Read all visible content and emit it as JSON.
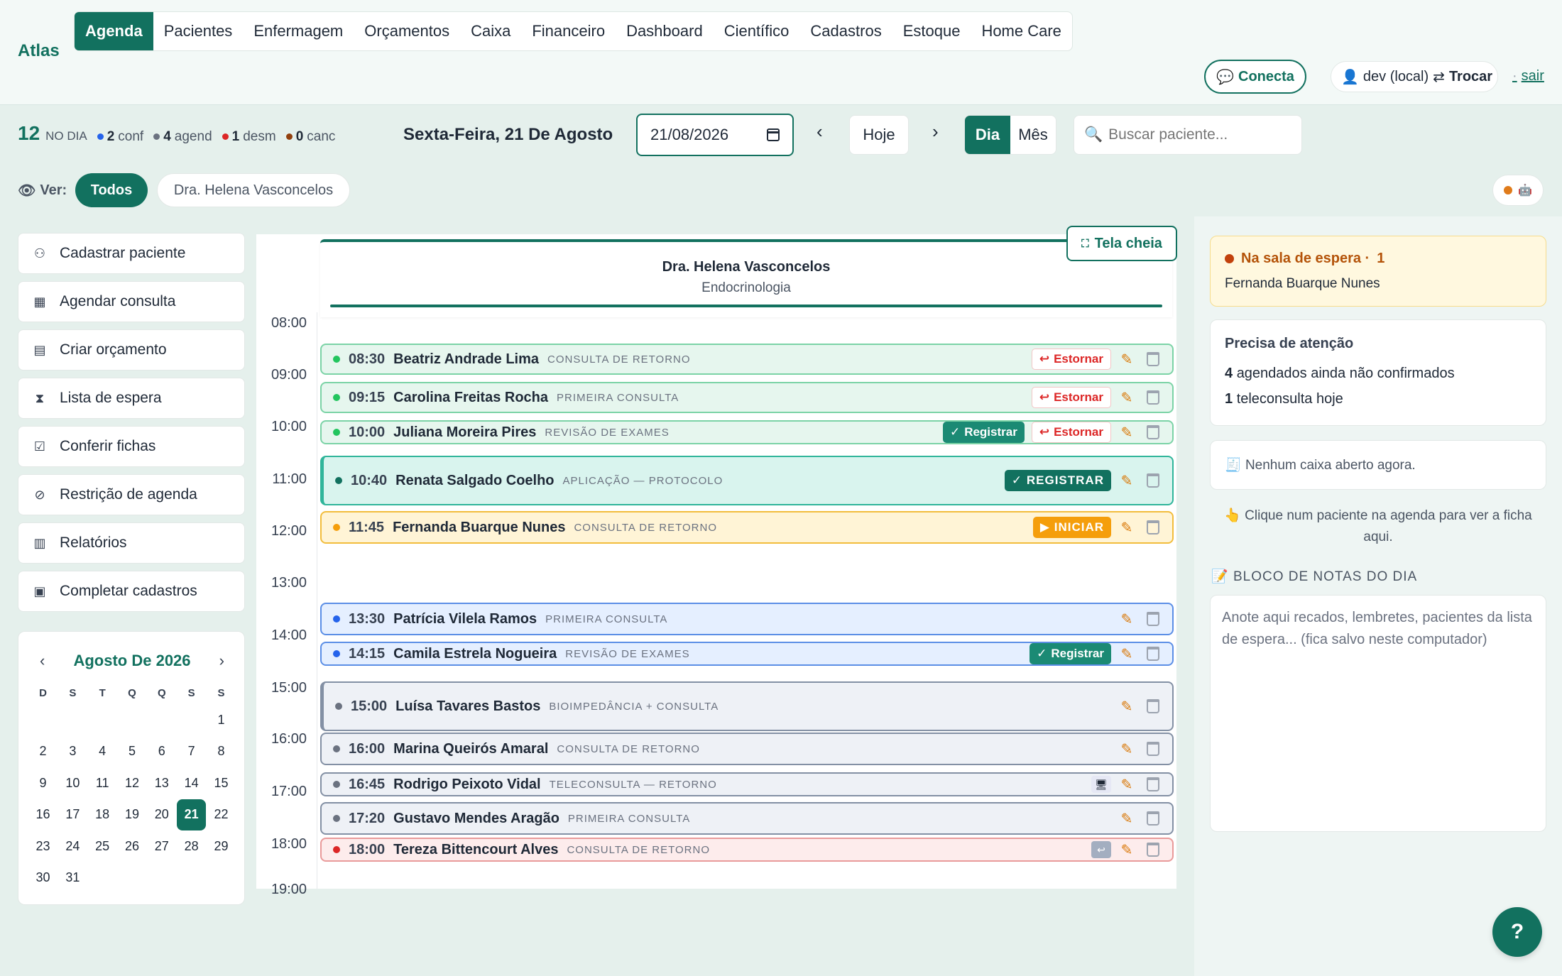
{
  "app": {
    "brand": "Atlas"
  },
  "nav": [
    "Agenda",
    "Pacientes",
    "Enfermagem",
    "Orçamentos",
    "Caixa",
    "Financeiro",
    "Dashboard",
    "Científico",
    "Cadastros",
    "Estoque",
    "Home Care"
  ],
  "header": {
    "conecta": "Conecta",
    "user": "dev (local)",
    "swap": "⇄",
    "trocar": "Trocar",
    "sep": "·",
    "sair": "sair"
  },
  "stats": {
    "total": "12",
    "total_label": "NO DIA",
    "conf": "2",
    "conf_label": "conf",
    "agend": "4",
    "agend_label": "agend",
    "desm": "1",
    "desm_label": "desm",
    "canc": "0",
    "canc_label": "canc",
    "colors": {
      "conf": "#2563eb",
      "agend": "#6b7280",
      "desm": "#dc2626",
      "canc": "#92400e"
    }
  },
  "toolbar": {
    "date_title": "Sexta-Feira, 21 De Agosto",
    "date_value": "21/08/2026",
    "prev": "‹",
    "next": "›",
    "hoje": "Hoje",
    "dia": "Dia",
    "mes": "Mês",
    "search_placeholder": "Buscar paciente..."
  },
  "filter": {
    "ver": "Ver:",
    "todos": "Todos",
    "doctor": "Dra. Helena Vasconcelos"
  },
  "sidebar": [
    {
      "label": "Cadastrar paciente",
      "icon": "user-plus-icon"
    },
    {
      "label": "Agendar consulta",
      "icon": "calendar-icon"
    },
    {
      "label": "Criar orçamento",
      "icon": "document-icon"
    },
    {
      "label": "Lista de espera",
      "icon": "hourglass-icon"
    },
    {
      "label": "Conferir fichas",
      "icon": "clipboard-check-icon"
    },
    {
      "label": "Restrição de agenda",
      "icon": "ban-icon"
    },
    {
      "label": "Relatórios",
      "icon": "bar-chart-icon"
    },
    {
      "label": "Completar cadastros",
      "icon": "id-card-icon"
    }
  ],
  "mini_calendar": {
    "title": "Agosto De 2026",
    "weekdays": [
      "D",
      "S",
      "T",
      "Q",
      "Q",
      "S",
      "S"
    ],
    "first_weekday": 6,
    "days": 31,
    "selected": 21
  },
  "schedule": {
    "doctor": "Dra. Helena Vasconcelos",
    "specialty": "Endocrinologia",
    "fullscreen": "Tela cheia",
    "hours": [
      "08:00",
      "09:00",
      "10:00",
      "11:00",
      "12:00",
      "13:00",
      "14:00",
      "15:00",
      "16:00",
      "17:00",
      "18:00",
      "19:00"
    ],
    "appointments": [
      {
        "time": "08:30",
        "name": "Beatriz Andrade Lima",
        "type": "CONSULTA DE RETORNO",
        "status": "green",
        "actions": [
          "estornar"
        ]
      },
      {
        "time": "09:15",
        "name": "Carolina Freitas Rocha",
        "type": "PRIMEIRA CONSULTA",
        "status": "green",
        "actions": [
          "estornar"
        ]
      },
      {
        "time": "10:00",
        "name": "Juliana Moreira Pires",
        "type": "REVISÃO DE EXAMES",
        "status": "green",
        "actions": [
          "registrar",
          "estornar"
        ]
      },
      {
        "time": "10:40",
        "name": "Renata Salgado Coelho",
        "type": "APLICAÇÃO — PROTOCOLO",
        "status": "teal",
        "actions": [
          "registrar_up"
        ]
      },
      {
        "time": "11:45",
        "name": "Fernanda Buarque Nunes",
        "type": "CONSULTA DE RETORNO",
        "status": "yellow",
        "actions": [
          "iniciar"
        ]
      },
      {
        "time": "13:30",
        "name": "Patrícia Vilela Ramos",
        "type": "PRIMEIRA CONSULTA",
        "status": "blue",
        "actions": []
      },
      {
        "time": "14:15",
        "name": "Camila Estrela Nogueira",
        "type": "REVISÃO DE EXAMES",
        "status": "blue",
        "actions": [
          "registrar"
        ]
      },
      {
        "time": "15:00",
        "name": "Luísa Tavares Bastos",
        "type": "BIOIMPEDÂNCIA + CONSULTA",
        "status": "gray",
        "actions": []
      },
      {
        "time": "16:00",
        "name": "Marina Queirós Amaral",
        "type": "CONSULTA DE RETORNO",
        "status": "gray",
        "actions": []
      },
      {
        "time": "16:45",
        "name": "Rodrigo Peixoto Vidal",
        "type": "TELECONSULTA — RETORNO",
        "status": "gray",
        "actions": [
          "monitor"
        ]
      },
      {
        "time": "17:20",
        "name": "Gustavo Mendes Aragão",
        "type": "PRIMEIRA CONSULTA",
        "status": "gray",
        "actions": []
      },
      {
        "time": "18:00",
        "name": "Tereza Bittencourt Alves",
        "type": "CONSULTA DE RETORNO",
        "status": "red",
        "actions": [
          "undo"
        ]
      }
    ],
    "labels": {
      "estornar": "Estornar",
      "registrar": "Registrar",
      "registrar_up": "✓ REGISTRAR",
      "iniciar": "▶ INICIAR"
    }
  },
  "right": {
    "wait_title": "Na sala de espera ·",
    "wait_count": "1",
    "wait_name": "Fernanda Buarque Nunes",
    "att_title": "Precisa de atenção",
    "att_1_n": "4",
    "att_1": "agendados ainda não confirmados",
    "att_2_n": "1",
    "att_2": "teleconsulta hoje",
    "caixa": "Nenhum caixa aberto agora.",
    "hint": "👆 Clique num paciente na agenda para ver a ficha aqui.",
    "notes_title": "BLOCO DE NOTAS DO DIA",
    "notes_placeholder": "Anote aqui recados, lembretes, pacientes da lista de espera... (fica salvo neste computador)",
    "help": "?"
  }
}
